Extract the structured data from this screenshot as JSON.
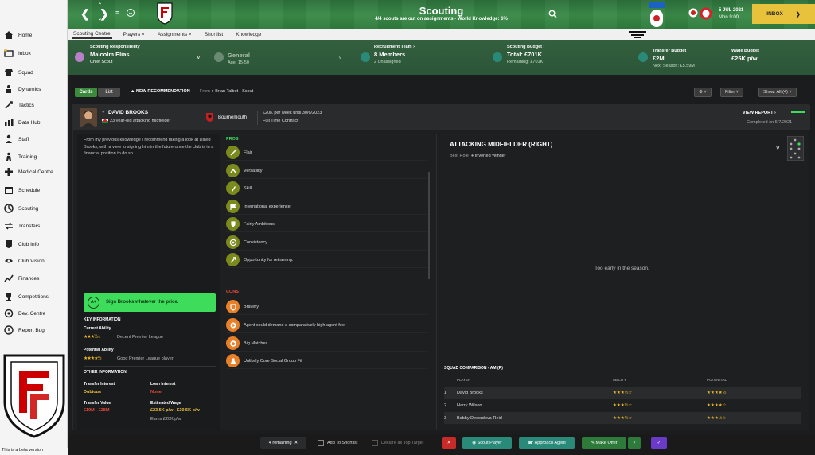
{
  "header": {
    "title": "Scouting",
    "subtitle": "4/4 scouts are out on assignments - World Knowledge: 6%",
    "date": "5 JUL 2021",
    "day_time": "Mon 9:00",
    "inbox_label": "INBOX"
  },
  "sidebar": {
    "items": [
      {
        "label": "Home",
        "icon": "home-icon"
      },
      {
        "label": "Inbox",
        "icon": "inbox-icon"
      },
      {
        "label": "Squad",
        "icon": "squad-icon"
      },
      {
        "label": "Dynamics",
        "icon": "dynamics-icon"
      },
      {
        "label": "Tactics",
        "icon": "tactics-icon"
      },
      {
        "label": "Data Hub",
        "icon": "data-hub-icon"
      },
      {
        "label": "Staff",
        "icon": "staff-icon"
      },
      {
        "label": "Training",
        "icon": "training-icon"
      },
      {
        "label": "Medical Centre",
        "icon": "medical-icon"
      },
      {
        "label": "Schedule",
        "icon": "schedule-icon"
      },
      {
        "label": "Scouting",
        "icon": "scouting-icon"
      },
      {
        "label": "Transfers",
        "icon": "transfers-icon"
      },
      {
        "label": "Club Info",
        "icon": "club-info-icon"
      },
      {
        "label": "Club Vision",
        "icon": "club-vision-icon"
      },
      {
        "label": "Finances",
        "icon": "finances-icon"
      },
      {
        "label": "Competitions",
        "icon": "competitions-icon"
      },
      {
        "label": "Dev. Centre",
        "icon": "dev-centre-icon"
      },
      {
        "label": "Report Bug",
        "icon": "report-bug-icon"
      }
    ],
    "beta_text": "This is a beta version"
  },
  "tabs": [
    "Scouting Centre",
    "Players",
    "Assignments",
    "Shortlist",
    "Knowledge"
  ],
  "info": {
    "resp_label": "Scouting Responsibility",
    "resp_name": "Malcolm Elias",
    "resp_role": "Chief Scout",
    "general_label": "General",
    "general_age": "Age: 15-50",
    "team_label": "Recruitment Team",
    "team_value": "8 Members",
    "team_sub": "2 Unassigned",
    "budget_label": "Scouting Budget",
    "budget_value": "Total: £701K",
    "budget_sub": "Remaining: £701K",
    "transfer_label": "Transfer Budget",
    "transfer_value": "£2M",
    "transfer_sub": "Next Season: £5.59M",
    "wage_label": "Wage Budget",
    "wage_value": "£25K p/w"
  },
  "toolbar": {
    "cards": "Cards",
    "list": "List",
    "new_rec": "NEW RECOMMENDATION",
    "from_label": "From",
    "from_value": "Brian Talbot - Scout",
    "filter": "Filter",
    "show": "Show: All (4)"
  },
  "player": {
    "name": "DAVID BROOKS",
    "desc": "23 year-old attacking midfielder",
    "club": "Bournemouth",
    "contract1": "£20K per week until 30/6/2023",
    "contract2": "Full Time Contract",
    "view_report": "VIEW REPORT",
    "completed": "Completed on 5/7/2021"
  },
  "report": {
    "text": "From my previous knowledge I recommend taking a look at David Brooks, with a view to signing him in the future once the club is in a financial position to do so.",
    "grade": "A+",
    "recommendation": "Sign Brooks whatever the price.",
    "key_info": "KEY INFORMATION",
    "current_ability": "Current Ability",
    "ca_stars": "★★★½☆",
    "ca_text": "Decent Premier League",
    "potential_ability": "Potential Ability",
    "pa_stars": "★★★★½",
    "pa_text": "Good Premier League player",
    "other_info": "OTHER INFORMATION",
    "transfer_interest": "Transfer Interest",
    "transfer_interest_value": "Dubious",
    "loan_interest": "Loan Interest",
    "loan_interest_value": "None",
    "transfer_value": "Transfer Value",
    "transfer_value_value": "£19M - £28M",
    "est_wage": "Estimated Wage",
    "est_wage_value": "£23.5K p/w - £30.5K p/w",
    "earns": "Earns £20K p/w"
  },
  "pros_label": "PROS",
  "pros": [
    {
      "label": "Flair",
      "icon": "flair-icon"
    },
    {
      "label": "Versatility",
      "icon": "versatility-icon"
    },
    {
      "label": "Skill",
      "icon": "skill-icon"
    },
    {
      "label": "International experience",
      "icon": "flag-icon"
    },
    {
      "label": "Fairly Ambitious",
      "icon": "ambition-icon"
    },
    {
      "label": "Consistency",
      "icon": "target-icon"
    },
    {
      "label": "Opportunity for retraining.",
      "icon": "retraining-icon"
    }
  ],
  "cons_label": "CONS",
  "cons": [
    {
      "label": "Bravery",
      "icon": "bravery-icon"
    },
    {
      "label": "Agent could demand a comparatively high agent fee.",
      "icon": "agent-icon"
    },
    {
      "label": "Big Matches",
      "icon": "ball-icon"
    },
    {
      "label": "Unlikely Core Social Group Fit",
      "icon": "social-icon"
    }
  ],
  "role": {
    "title": "ATTACKING MIDFIELDER (RIGHT)",
    "best_role_label": "Best Role",
    "best_role_value": "Inverted Winger",
    "early_text": "Too early in the season."
  },
  "squad": {
    "heading": "SQUAD COMPARISON - AM (R)",
    "col_player": "PLAYER",
    "col_ability": "ABILITY",
    "col_potential": "POTENTIAL",
    "rows": [
      {
        "n": "1",
        "name": "David Brooks",
        "ability": "★★★½☆",
        "potential": "★★★★½"
      },
      {
        "n": "2",
        "name": "Harry Wilson",
        "ability": "★★★½☆",
        "potential": "★★★★☆"
      },
      {
        "n": "3",
        "name": "Bobby Decordova-Reid",
        "ability": "★★★½☆",
        "potential": "★★★½☆"
      }
    ]
  },
  "bottom": {
    "remaining": "4 remaining",
    "add_shortlist": "Add To Shortlist",
    "declare_target": "Declare as Top Target",
    "scout_player": "Scout Player",
    "approach_agent": "Approach Agent",
    "make_offer": "Make Offer"
  },
  "colors": {
    "accent_green": "#3ddc5a",
    "inbox_yellow": "#e8c23a",
    "star": "#e8b828",
    "bad": "#e84a3a",
    "teal": "#2a8a7a"
  }
}
